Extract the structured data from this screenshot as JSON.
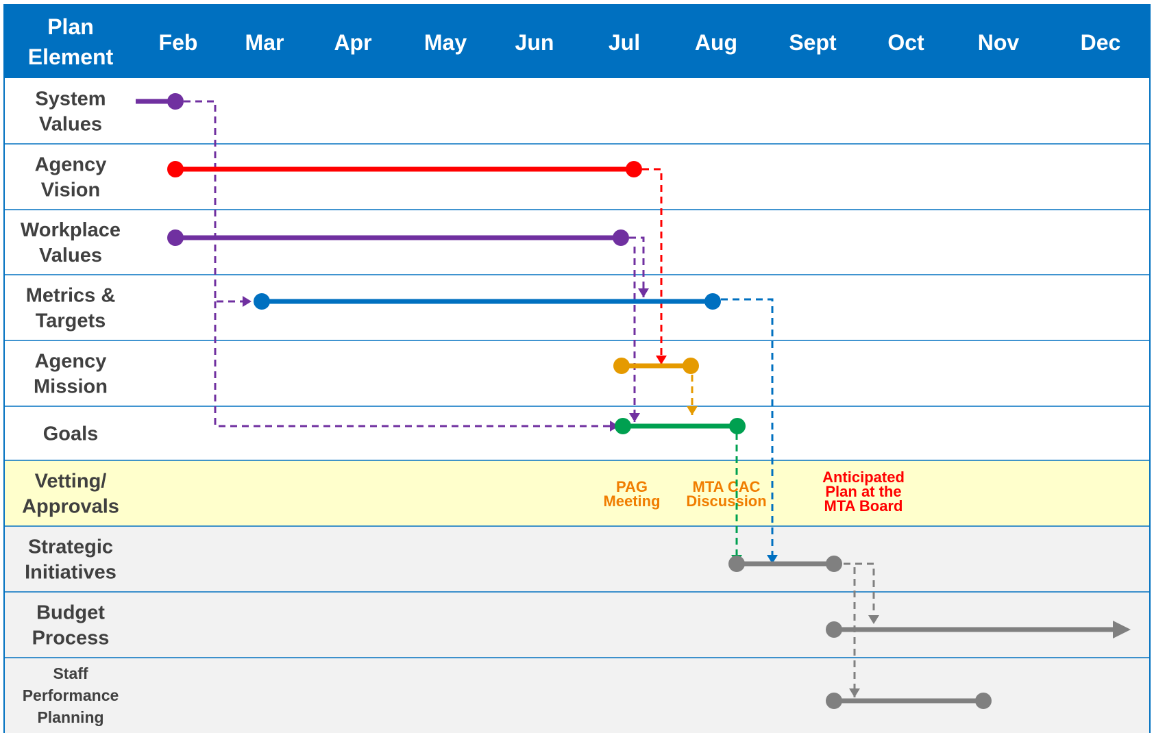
{
  "header": {
    "corner_label": [
      "Plan",
      "Element"
    ],
    "months": [
      "Feb",
      "Mar",
      "Apr",
      "May",
      "Jun",
      "Jul",
      "Aug",
      "Sept",
      "Oct",
      "Nov",
      "Dec"
    ]
  },
  "rows": [
    {
      "label": [
        "System",
        "Values"
      ],
      "kind": "plain"
    },
    {
      "label": [
        "Agency",
        "Vision"
      ],
      "kind": "plain"
    },
    {
      "label": [
        "Workplace",
        "Values"
      ],
      "kind": "plain"
    },
    {
      "label": [
        "Metrics &",
        "Targets"
      ],
      "kind": "plain"
    },
    {
      "label": [
        "Agency",
        "Mission"
      ],
      "kind": "plain"
    },
    {
      "label": [
        "Goals"
      ],
      "kind": "plain"
    },
    {
      "label": [
        "Vetting/",
        "Approvals"
      ],
      "kind": "vetting"
    },
    {
      "label": [
        "Strategic",
        "Initiatives"
      ],
      "kind": "grey"
    },
    {
      "label": [
        "Budget",
        "Process"
      ],
      "kind": "grey"
    },
    {
      "label": [
        "Staff",
        "Performance",
        "Planning"
      ],
      "kind": "grey",
      "small": true
    }
  ],
  "milestones": [
    {
      "text": [
        "PAG",
        "Meeting"
      ],
      "color": "#f07d00"
    },
    {
      "text": [
        "MTA CAC",
        "Discussion"
      ],
      "color": "#f07d00"
    },
    {
      "text": [
        "Anticipated",
        "Plan at the",
        "MTA Board"
      ],
      "color": "#ff0000"
    }
  ],
  "colors": {
    "header_bg": "#0070c0",
    "header_text": "#ffffff",
    "row_label_text": "#404040",
    "grid_line": "#0070c0",
    "vetting_bg": "#ffffcc",
    "grey_bg": "#f2f2f2",
    "purple": "#7030a0",
    "red": "#ff0000",
    "blue": "#0070c0",
    "orange": "#e59a00",
    "green": "#00a050",
    "grey": "#808080"
  },
  "bars": [
    {
      "name": "system-values",
      "color": "purple",
      "start_dot": false
    },
    {
      "name": "agency-vision",
      "color": "red",
      "start_dot": true
    },
    {
      "name": "workplace-values",
      "color": "purple",
      "start_dot": true
    },
    {
      "name": "metrics-targets",
      "color": "blue",
      "start_dot": true
    },
    {
      "name": "agency-mission",
      "color": "orange",
      "start_dot": true
    },
    {
      "name": "goals",
      "color": "green",
      "start_dot": true
    },
    {
      "name": "strategic-initiatives",
      "color": "grey",
      "start_dot": true
    },
    {
      "name": "budget-process",
      "color": "grey",
      "start_dot": true,
      "end_arrow": true
    },
    {
      "name": "staff-performance-planning",
      "color": "grey",
      "start_dot": true
    }
  ]
}
